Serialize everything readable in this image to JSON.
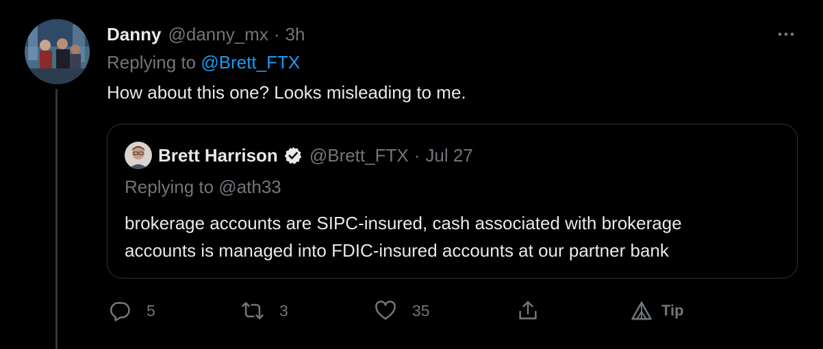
{
  "tweet": {
    "author_name": "Danny",
    "author_handle": "@danny_mx",
    "separator": "·",
    "time": "3h",
    "replying_prefix": "Replying to",
    "replying_handle": "@Brett_FTX",
    "text": "How about this one? Looks misleading to me."
  },
  "quoted": {
    "author_name": "Brett Harrison",
    "author_handle": "@Brett_FTX",
    "separator": "·",
    "date": "Jul 27",
    "replying": "Replying to @ath33",
    "text_line1": "brokerage accounts are SIPC-insured, cash associated with brokerage",
    "text_line2": "accounts is managed into FDIC-insured accounts at our partner bank"
  },
  "actions": {
    "replies": "5",
    "retweets": "3",
    "likes": "35",
    "tip_label": "Tip"
  },
  "icons": {
    "more": "more-dots-icon",
    "reply": "reply-bubble-icon",
    "retweet": "retweet-arrows-icon",
    "like": "heart-icon",
    "share": "share-upload-icon",
    "tip": "tip-triangle-icon",
    "verified": "verified-badge-icon"
  },
  "colors": {
    "background": "#000000",
    "text": "#e7e9ea",
    "muted": "#71767b",
    "link": "#1d9bf0",
    "border": "#2f3336"
  }
}
